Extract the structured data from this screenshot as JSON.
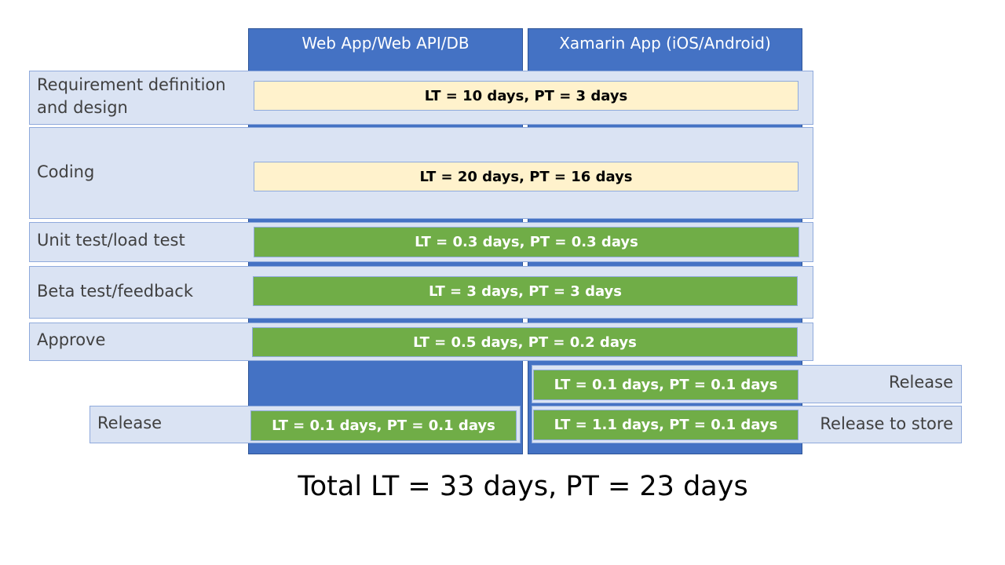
{
  "columns": {
    "web": "Web App/Web API/DB",
    "xamarin": "Xamarin App (iOS/Android)"
  },
  "phases": {
    "requirement": {
      "label": "Requirement definition and design",
      "metric": "LT = 10 days, PT = 3 days"
    },
    "coding": {
      "label": "Coding",
      "metric": "LT = 20 days, PT = 16 days"
    },
    "unit_test": {
      "label": "Unit test/load test",
      "metric": "LT = 0.3 days, PT = 0.3 days"
    },
    "beta_test": {
      "label": "Beta test/feedback",
      "metric": "LT = 3 days, PT = 3 days"
    },
    "approve": {
      "label": "Approve",
      "metric": "LT = 0.5 days, PT = 0.2 days"
    },
    "web_release": {
      "label": "Release",
      "metric": "LT = 0.1 days, PT = 0.1 days"
    },
    "xamarin_release": {
      "label": "Release",
      "metric": "LT = 0.1 days, PT = 0.1 days"
    },
    "xamarin_store": {
      "label": "Release to store",
      "metric": "LT = 1.1 days, PT = 0.1 days"
    }
  },
  "total": "Total LT = 33 days, PT = 23 days",
  "colors": {
    "column_blue": "#4472c4",
    "band_light_blue": "#dae3f3",
    "bar_yellow": "#fff2cc",
    "bar_green": "#70ad47"
  }
}
